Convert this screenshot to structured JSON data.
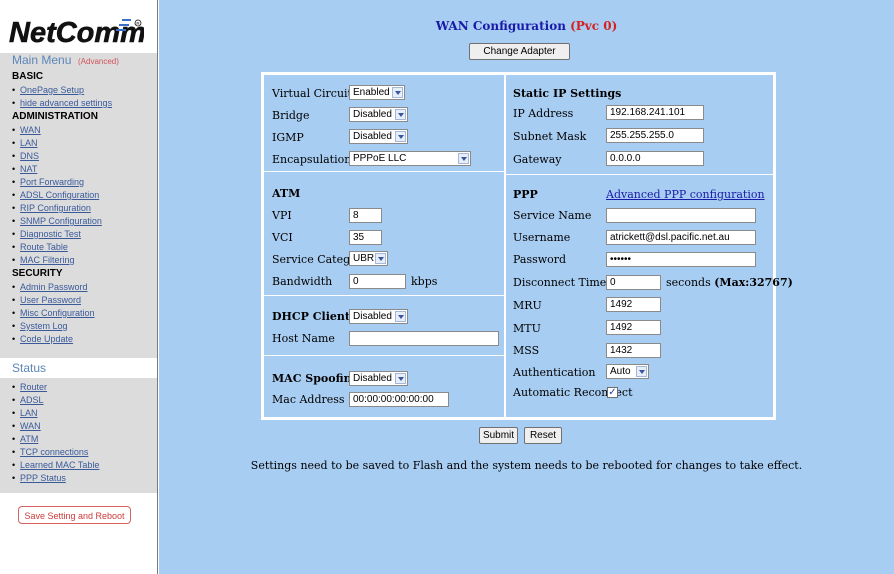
{
  "sidebar": {
    "logo_text": "NetComm",
    "main_menu_title": "Main Menu",
    "advanced_tag": "(Advanced)",
    "basic_heading": "BASIC",
    "basic_items": [
      "OnePage Setup",
      "hide advanced settings"
    ],
    "admin_heading": "ADMINISTRATION",
    "admin_items": [
      "WAN",
      "LAN",
      "DNS",
      "NAT",
      "Port Forwarding",
      "ADSL Configuration",
      "RIP Configuration",
      "SNMP Configuration",
      "Diagnostic Test",
      "Route Table",
      "MAC Filtering"
    ],
    "security_heading": "SECURITY",
    "security_items": [
      "Admin Password",
      "User Password",
      "Misc Configuration",
      "System Log",
      "Code Update"
    ],
    "status_title": "Status",
    "status_items": [
      "Router",
      "ADSL",
      "LAN",
      "WAN",
      "ATM",
      "TCP connections",
      "Learned MAC Table",
      "PPP Status"
    ],
    "save_reboot_label": "Save Setting and Reboot"
  },
  "main": {
    "title": "WAN Configuration",
    "pvc": "(Pvc 0)",
    "change_adapter_label": "Change Adapter",
    "left": {
      "virtual_circuit_label": "Virtual Circuit",
      "virtual_circuit_value": "Enabled",
      "bridge_label": "Bridge",
      "bridge_value": "Disabled",
      "igmp_label": "IGMP",
      "igmp_value": "Disabled",
      "encapsulation_label": "Encapsulation",
      "encapsulation_value": "PPPoE LLC",
      "atm_heading": "ATM",
      "vpi_label": "VPI",
      "vpi_value": "8",
      "vci_label": "VCI",
      "vci_value": "35",
      "service_category_label": "Service Category",
      "service_category_value": "UBR",
      "bandwidth_label": "Bandwidth",
      "bandwidth_value": "0",
      "bandwidth_unit": "kbps",
      "dhcp_heading": "DHCP Client",
      "dhcp_value": "Disabled",
      "host_name_label": "Host Name",
      "host_name_value": "",
      "mac_spoofing_heading": "MAC Spoofing",
      "mac_spoofing_value": "Disabled",
      "mac_address_label": "Mac Address",
      "mac_address_value": "00:00:00:00:00:00"
    },
    "right": {
      "static_ip_heading": "Static IP Settings",
      "ip_address_label": "IP Address",
      "ip_address_value": "192.168.241.101",
      "subnet_mask_label": "Subnet Mask",
      "subnet_mask_value": "255.255.255.0",
      "gateway_label": "Gateway",
      "gateway_value": "0.0.0.0",
      "ppp_heading": "PPP",
      "advanced_ppp_link": "Advanced PPP configuration",
      "service_name_label": "Service Name",
      "service_name_value": "",
      "username_label": "Username",
      "username_value": "atrickett@dsl.pacific.net.au",
      "password_label": "Password",
      "password_value": "••••••",
      "disconnect_timeout_label": "Disconnect Timeout",
      "disconnect_timeout_value": "0",
      "disconnect_timeout_suffix": "seconds",
      "disconnect_timeout_max": "(Max:32767)",
      "mru_label": "MRU",
      "mru_value": "1492",
      "mtu_label": "MTU",
      "mtu_value": "1492",
      "mss_label": "MSS",
      "mss_value": "1432",
      "authentication_label": "Authentication",
      "authentication_value": "Auto",
      "auto_reconnect_label": "Automatic Reconnect",
      "auto_reconnect_mark": "✓"
    },
    "submit_label": "Submit",
    "reset_label": "Reset",
    "note": "Settings need to be saved to Flash and the system needs to be rebooted for changes to take effect."
  }
}
